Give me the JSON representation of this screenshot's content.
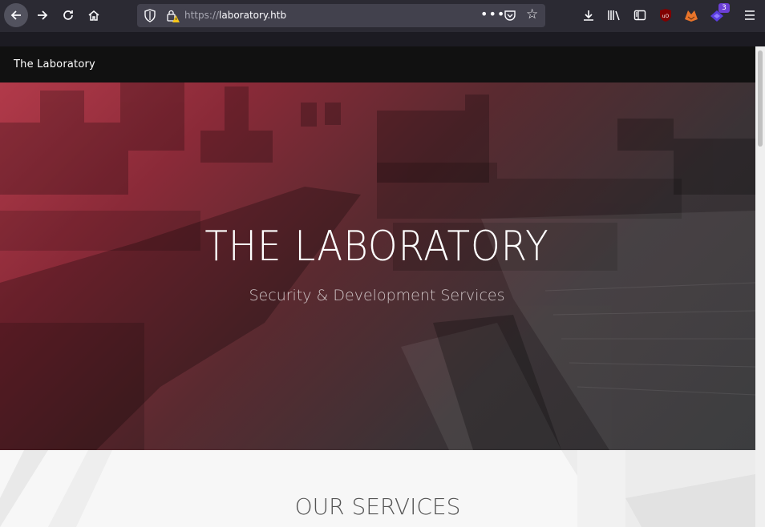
{
  "browser": {
    "url_protocol": "https://",
    "url_host": "laboratory.htb",
    "extension_badge": "3"
  },
  "site": {
    "brand": "The Laboratory",
    "hero_title": "THE LABORATORY",
    "hero_subtitle": "Security & Development Services",
    "section_title": "OUR SERVICES"
  },
  "colors": {
    "hero_gradient_start": "#b23a4a",
    "hero_gradient_end": "#2e2f31",
    "navbar": "#111111"
  }
}
